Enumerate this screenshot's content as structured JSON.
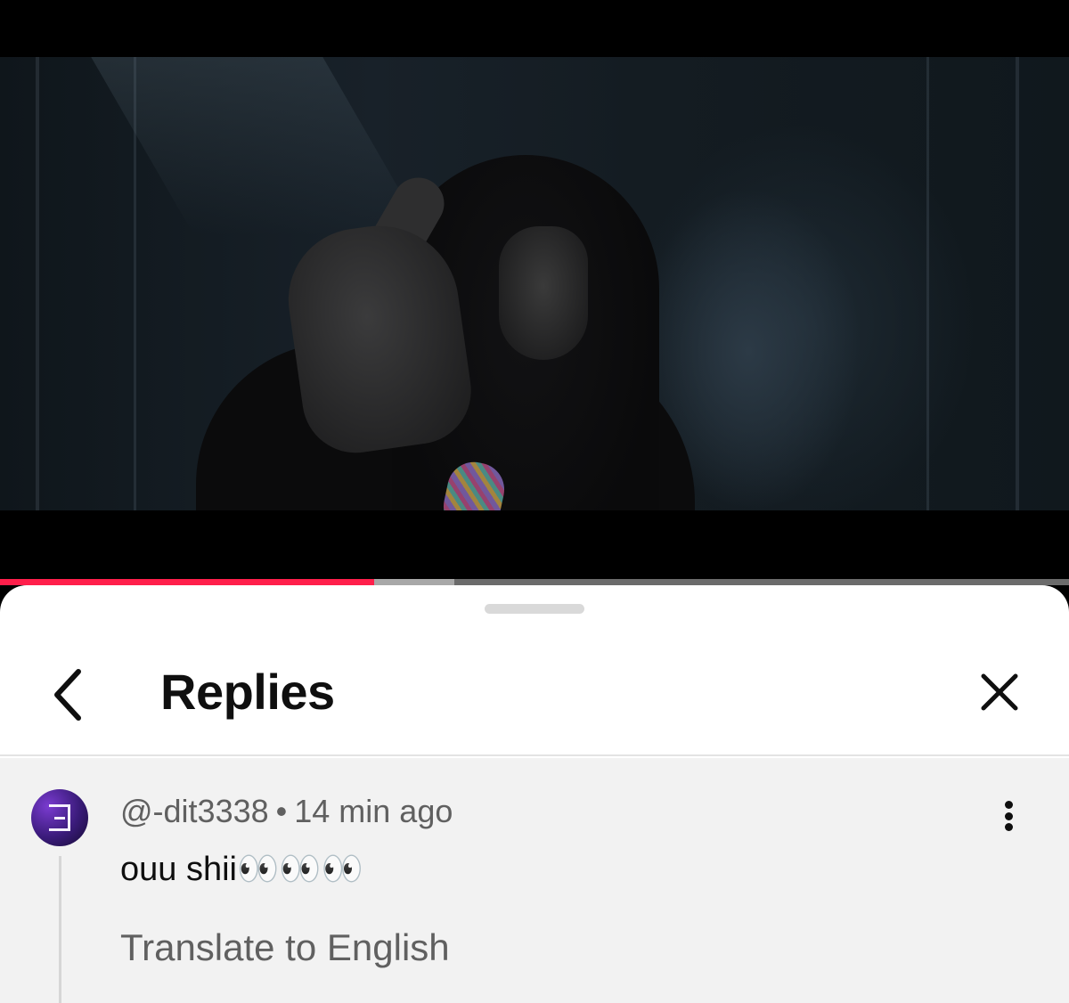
{
  "video": {
    "progress_fraction": 0.35,
    "buffer_fraction": 0.425,
    "colors": {
      "played": "#ff1f4b",
      "buffered": "#a8a8a8",
      "track": "#6b6b6b"
    }
  },
  "replies_panel": {
    "title": "Replies",
    "back_icon": "chevron-left-icon",
    "close_icon": "close-icon"
  },
  "comment": {
    "author": "@-dit3338",
    "separator": "•",
    "time": "14 min ago",
    "text": "ouu shii👀👀👀",
    "translate_label": "Translate to English",
    "more_icon": "more-vertical-icon",
    "avatar_icon": "avatar-logo-icon"
  }
}
